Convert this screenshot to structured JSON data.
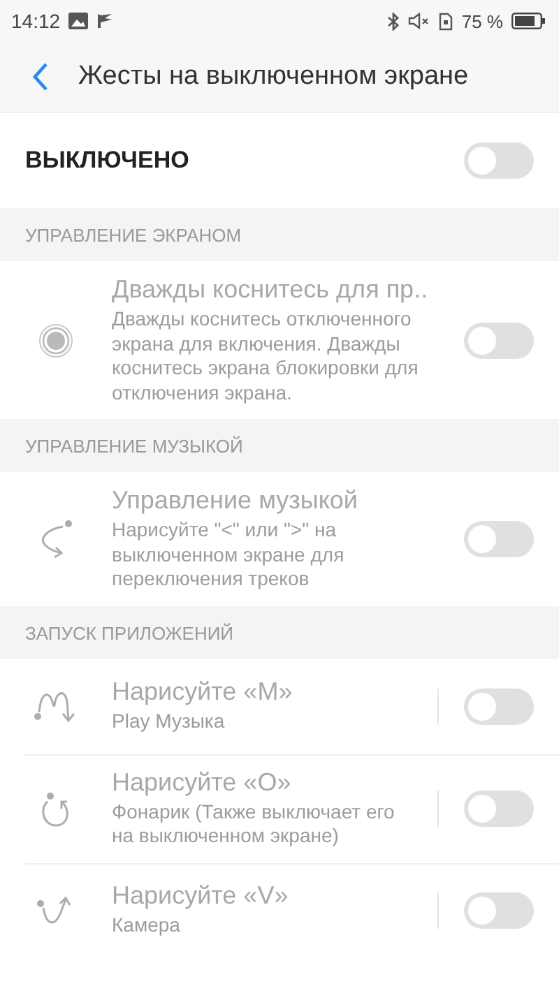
{
  "status_bar": {
    "time": "14:12",
    "battery": "75 %"
  },
  "header": {
    "title": "Жесты на выключенном экране"
  },
  "master": {
    "label": "ВЫКЛЮЧЕНО",
    "on": false
  },
  "sections": [
    {
      "title": "УПРАВЛЕНИЕ ЭКРАНОМ",
      "kind": "setting",
      "items": [
        {
          "kind": "double-tap",
          "title": "Дважды коснитесь для пр..",
          "description": "Дважды коснитесь отключенного экрана для включения. Дважды коснитесь экрана блокировки для отключения экрана.",
          "on": false,
          "disabled": true
        }
      ]
    },
    {
      "title": "УПРАВЛЕНИЕ МУЗЫКОЙ",
      "kind": "setting",
      "items": [
        {
          "kind": "swipe",
          "title": "Управление музыкой",
          "description": "Нарисуйте \"<\" или \">\" на выключенном экране для переключения треков",
          "on": false,
          "disabled": true
        }
      ]
    },
    {
      "title": "ЗАПУСК ПРИЛОЖЕНИЙ",
      "kind": "launcher",
      "items": [
        {
          "kind": "m",
          "title": "Нарисуйте «M»",
          "description": "Play Музыка",
          "on": false,
          "disabled": true
        },
        {
          "kind": "o",
          "title": "Нарисуйте «O»",
          "description": "Фонарик (Также выключает его на выключенном экране)",
          "on": false,
          "disabled": true
        },
        {
          "kind": "v",
          "title": "Нарисуйте «V»",
          "description": "Камера",
          "on": false,
          "disabled": true
        }
      ]
    }
  ]
}
